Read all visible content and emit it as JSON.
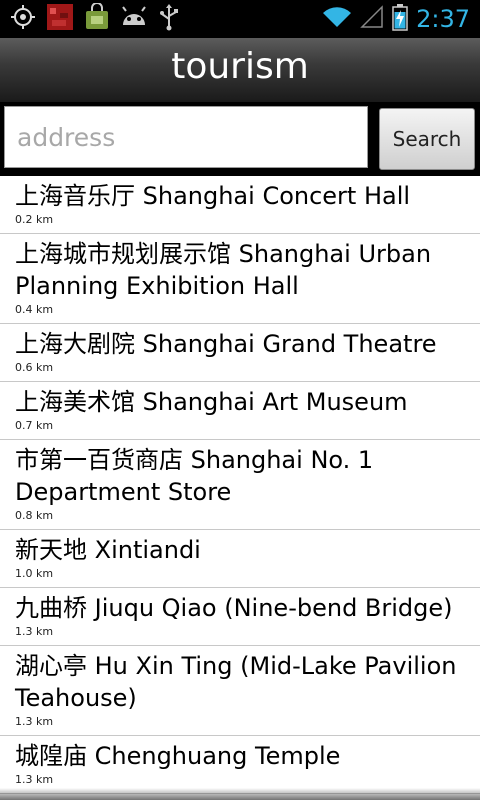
{
  "status_bar": {
    "time": "2:37",
    "time_color": "#33b5e5",
    "icons": [
      "gps-icon",
      "red-app-icon",
      "market-bag-icon",
      "android-debug-icon",
      "usb-icon",
      "wifi-icon",
      "no-signal-icon",
      "battery-charging-icon"
    ]
  },
  "header": {
    "title": "tourism"
  },
  "search": {
    "placeholder": "address",
    "button_label": "Search"
  },
  "places": [
    {
      "name": "上海音乐厅 Shanghai Concert Hall",
      "distance": "0.2 km"
    },
    {
      "name": "上海城市规划展示馆 Shanghai Urban Planning Exhibition Hall",
      "distance": "0.4 km"
    },
    {
      "name": "上海大剧院 Shanghai Grand Theatre",
      "distance": "0.6 km"
    },
    {
      "name": "上海美术馆 Shanghai Art Museum",
      "distance": "0.7 km"
    },
    {
      "name": "市第一百货商店 Shanghai No. 1 Department Store",
      "distance": "0.8 km"
    },
    {
      "name": "新天地 Xintiandi",
      "distance": "1.0 km"
    },
    {
      "name": "九曲桥 Jiuqu Qiao (Nine-bend Bridge)",
      "distance": "1.3 km"
    },
    {
      "name": "湖心亭 Hu Xin Ting (Mid-Lake Pavilion Teahouse)",
      "distance": "1.3 km"
    },
    {
      "name": "城隍庙 Chenghuang Temple",
      "distance": "1.3 km"
    }
  ]
}
